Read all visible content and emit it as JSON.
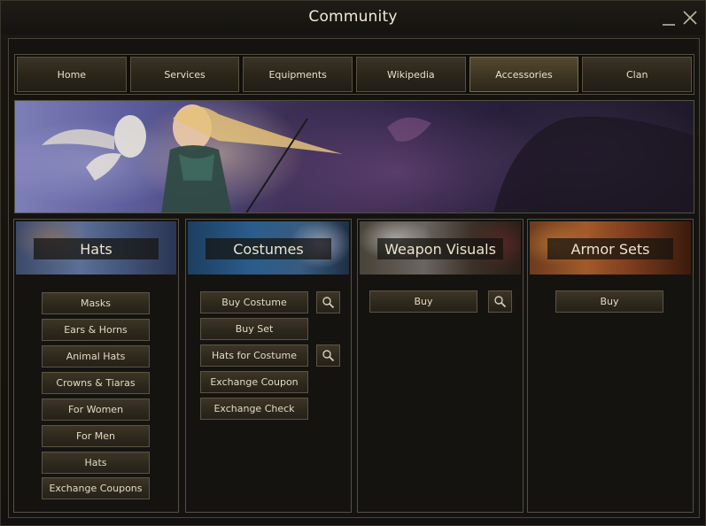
{
  "window": {
    "title": "Community"
  },
  "nav": {
    "tabs": [
      {
        "label": "Home"
      },
      {
        "label": "Services"
      },
      {
        "label": "Equipments"
      },
      {
        "label": "Wikipedia"
      },
      {
        "label": "Accessories"
      },
      {
        "label": "Clan"
      }
    ],
    "active": "Accessories"
  },
  "columns": {
    "hats": {
      "title": "Hats",
      "buttons": [
        "Masks",
        "Ears & Horns",
        "Animal Hats",
        "Crowns & Tiaras",
        "For Women",
        "For Men",
        "Hats",
        "Exchange Coupons"
      ]
    },
    "costumes": {
      "title": "Costumes",
      "buttons": [
        "Buy Costume",
        "Buy Set",
        "Hats for Costume",
        "Exchange Coupon",
        "Exchange Check"
      ]
    },
    "weapon_visuals": {
      "title": "Weapon Visuals",
      "buttons": [
        "Buy"
      ]
    },
    "armor_sets": {
      "title": "Armor Sets",
      "buttons": [
        "Buy"
      ]
    }
  },
  "icons": {
    "preview": "preview-icon",
    "close": "close-icon",
    "minimize": "minimize-icon"
  },
  "colors": {
    "accent": "#7a6c4d",
    "text": "#e3d9c2",
    "border": "#55503f"
  }
}
